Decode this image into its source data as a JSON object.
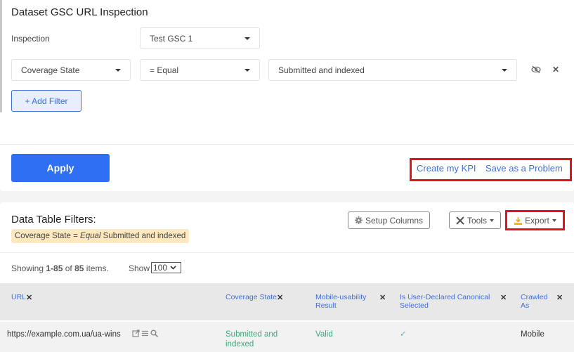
{
  "header": {
    "title": "Dataset GSC URL Inspection"
  },
  "inspection": {
    "label": "Inspection",
    "value": "Test GSC 1"
  },
  "filter": {
    "field": "Coverage State",
    "operator": "= Equal",
    "value": "Submitted and indexed",
    "hide_icon": "eye-slash-icon",
    "remove_icon": "close-icon",
    "remove_glyph": "✕"
  },
  "add_filter_label": "+ Add Filter",
  "apply_label": "Apply",
  "actions": {
    "create_kpi": "Create my KPI",
    "save_problem": "Save as a Problem"
  },
  "data_table": {
    "title": "Data Table Filters:",
    "chip": {
      "field": "Coverage State = ",
      "operator": "Equal",
      "value": " Submitted and indexed"
    },
    "setup_columns": "Setup Columns",
    "tools": "Tools",
    "export": "Export",
    "showing": {
      "prefix": "Showing ",
      "range": "1-85",
      "of": " of ",
      "total": "85",
      "suffix": " items."
    },
    "show_label": "Show",
    "page_size": "100",
    "columns": [
      {
        "label": "URL"
      },
      {
        "label": "Coverage State"
      },
      {
        "label": "Mobile-usability Result"
      },
      {
        "label": "Is User-Declared Canonical Selected"
      },
      {
        "label": "Crawled As"
      }
    ],
    "close_glyph": "✕",
    "rows": [
      {
        "url": "https://example.com.ua/ua-wins",
        "coverage_state": "Submitted and indexed",
        "mobile_usability": "Valid",
        "canonical_selected": "✓",
        "crawled_as": "Mobile"
      }
    ]
  },
  "colors": {
    "accent": "#2f6ff3",
    "link": "#3f6fd8",
    "highlight": "#e0121f",
    "chip": "#fde8c0",
    "success": "#3aaa7a",
    "export_icon": "#f0b400"
  }
}
